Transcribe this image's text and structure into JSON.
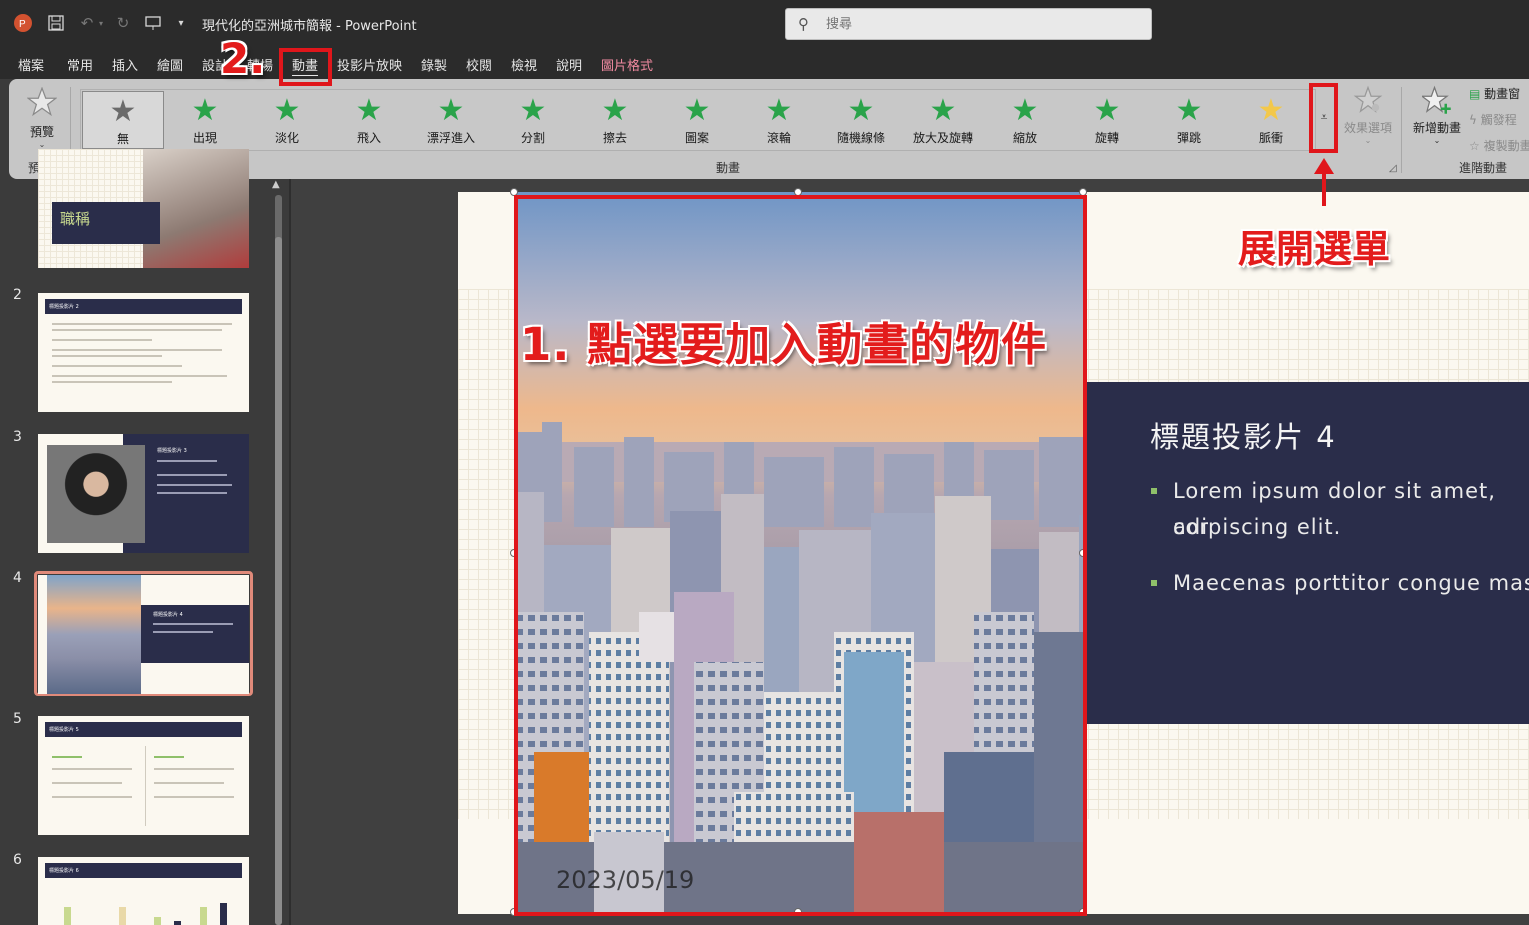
{
  "titlebar": {
    "doc_title": "現代化的亞洲城市簡報  -  PowerPoint",
    "search_placeholder": "搜尋"
  },
  "tabs": [
    "檔案",
    "常用",
    "插入",
    "繪圖",
    "設計",
    "轉場",
    "動畫",
    "投影片放映",
    "錄製",
    "校閱",
    "檢視",
    "說明",
    "圖片格式"
  ],
  "active_tab": "動畫",
  "ribbon": {
    "preview": {
      "label": "預覽",
      "group_label": "預覽"
    },
    "animations_group_label": "動畫",
    "animations": [
      "無",
      "出現",
      "淡化",
      "飛入",
      "漂浮進入",
      "分割",
      "擦去",
      "圖案",
      "滾輪",
      "隨機線條",
      "放大及旋轉",
      "縮放",
      "旋轉",
      "彈跳",
      "脈衝"
    ],
    "selected_animation": "無",
    "effect_options": "效果選項",
    "add_animation": "新增動畫",
    "animation_pane": "動畫窗",
    "trigger": "觸發程",
    "animation_painter": "複製動畫",
    "advanced_group_label": "進階動畫"
  },
  "slides": {
    "numbers": [
      "2",
      "3",
      "4",
      "5",
      "6"
    ],
    "selected": "4",
    "thumb1_title": "職稱",
    "thumb2_title": "標題投影片 2",
    "thumb3_title": "標題投影片 3",
    "thumb4_title": "標題投影片 4",
    "thumb5_title": "標題投影片 5",
    "thumb6_title": "標題投影片 6"
  },
  "slide": {
    "title": "標題投影片 4",
    "bullets": [
      "Lorem ipsum dolor sit amet, cor",
      "adipiscing elit.",
      "Maecenas porttitor congue mas"
    ],
    "photo_date": "2023/05/19"
  },
  "annotations": {
    "step1": "1. 點選要加入動畫的物件",
    "step2": "2.",
    "expand_menu": "展開選單"
  },
  "colors": {
    "annotation_red": "#e0161b",
    "title_box": "#2a2d4a",
    "bullet_green": "#8fc06a",
    "star_green": "#2aa34a",
    "picture_format_tab": "#f08aa0"
  }
}
